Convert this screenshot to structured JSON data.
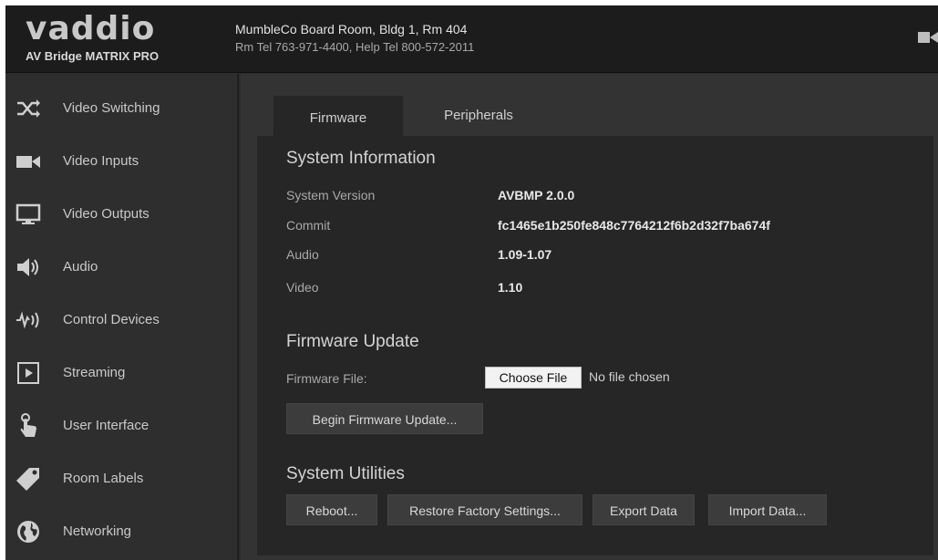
{
  "header": {
    "brand": "vaddio",
    "product": "AV Bridge MATRIX PRO",
    "room_name": "MumbleCo Board Room, Bldg 1, Rm 404",
    "room_tel": "Rm Tel 763-971-4400, Help Tel 800-572-2011"
  },
  "sidebar": {
    "items": [
      {
        "label": "Video Switching",
        "icon": "shuffle-icon"
      },
      {
        "label": "Video Inputs",
        "icon": "video-camera-icon"
      },
      {
        "label": "Video Outputs",
        "icon": "monitor-icon"
      },
      {
        "label": "Audio",
        "icon": "speaker-icon"
      },
      {
        "label": "Control Devices",
        "icon": "signal-icon"
      },
      {
        "label": "Streaming",
        "icon": "play-icon"
      },
      {
        "label": "User Interface",
        "icon": "touch-hand-icon"
      },
      {
        "label": "Room Labels",
        "icon": "tag-icon"
      },
      {
        "label": "Networking",
        "icon": "globe-icon"
      }
    ]
  },
  "tabs": [
    {
      "label": "Firmware",
      "active": true
    },
    {
      "label": "Peripherals",
      "active": false
    }
  ],
  "system_info": {
    "title": "System Information",
    "rows": [
      {
        "label": "System Version",
        "value": "AVBMP 2.0.0"
      },
      {
        "label": "Commit",
        "value": "fc1465e1b250fe848c7764212f6b2d32f7ba674f"
      },
      {
        "label": "Audio",
        "value": "1.09-1.07"
      },
      {
        "label": "Video",
        "value": "1.10"
      }
    ]
  },
  "firmware_update": {
    "title": "Firmware Update",
    "file_label": "Firmware File:",
    "choose_label": "Choose File",
    "file_status": "No file chosen",
    "begin_label": "Begin Firmware Update..."
  },
  "system_utilities": {
    "title": "System Utilities",
    "reboot_label": "Reboot...",
    "restore_label": "Restore Factory Settings...",
    "export_label": "Export Data",
    "import_label": "Import Data..."
  },
  "colors": {
    "background": "#2b2b2b",
    "header": "#1c1c1c",
    "panel": "#262626",
    "text": "#d4d4d4"
  }
}
